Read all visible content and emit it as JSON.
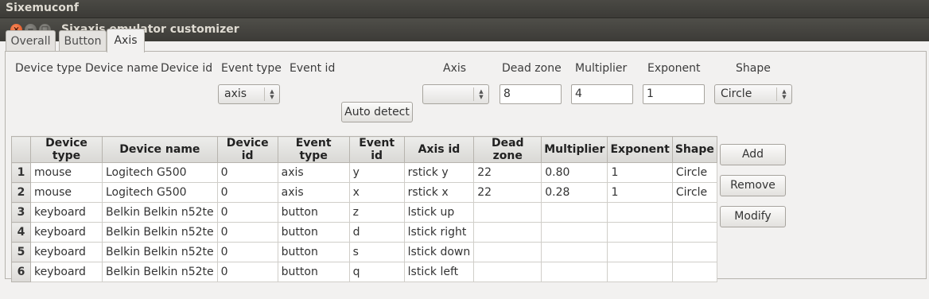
{
  "app": {
    "top_title": "Sixemuconf"
  },
  "window": {
    "title": "Sixaxis emulator customizer",
    "close_glyph": "×",
    "min_glyph": "−",
    "max_glyph": "□"
  },
  "tabs": [
    {
      "label": "Overall"
    },
    {
      "label": "Button"
    },
    {
      "label": "Axis",
      "active": true
    }
  ],
  "form": {
    "labels": {
      "device_type": "Device type",
      "device_name": "Device name",
      "device_id": "Device id",
      "event_type": "Event type",
      "event_id": "Event id",
      "axis": "Axis",
      "dead_zone": "Dead zone",
      "multiplier": "Multiplier",
      "exponent": "Exponent",
      "shape": "Shape"
    },
    "event_type_value": "axis",
    "auto_detect_label": "Auto detect",
    "axis_value": "",
    "dead_zone_value": "8",
    "multiplier_value": "4",
    "exponent_value": "1",
    "shape_value": "Circle"
  },
  "table": {
    "columns": [
      "Device type",
      "Device name",
      "Device id",
      "Event type",
      "Event id",
      "Axis id",
      "Dead zone",
      "Multiplier",
      "Exponent",
      "Shape"
    ],
    "rows": [
      {
        "num": "1",
        "cells": [
          "mouse",
          "Logitech G500",
          "0",
          "axis",
          "y",
          "rstick y",
          "22",
          "0.80",
          "1",
          "Circle"
        ]
      },
      {
        "num": "2",
        "cells": [
          "mouse",
          "Logitech G500",
          "0",
          "axis",
          "x",
          "rstick x",
          "22",
          "0.28",
          "1",
          "Circle"
        ]
      },
      {
        "num": "3",
        "cells": [
          "keyboard",
          "Belkin Belkin n52te",
          "0",
          "button",
          "z",
          "lstick up",
          "",
          "",
          "",
          ""
        ]
      },
      {
        "num": "4",
        "cells": [
          "keyboard",
          "Belkin Belkin n52te",
          "0",
          "button",
          "d",
          "lstick right",
          "",
          "",
          "",
          ""
        ]
      },
      {
        "num": "5",
        "cells": [
          "keyboard",
          "Belkin Belkin n52te",
          "0",
          "button",
          "s",
          "lstick down",
          "",
          "",
          "",
          ""
        ]
      },
      {
        "num": "6",
        "cells": [
          "keyboard",
          "Belkin Belkin n52te",
          "0",
          "button",
          "q",
          "lstick left",
          "",
          "",
          "",
          ""
        ]
      }
    ]
  },
  "actions": {
    "add_label": "Add",
    "remove_label": "Remove",
    "modify_label": "Modify"
  },
  "colors": {
    "titlebar": "#3c3b37",
    "window_bg": "#f2f1f0",
    "close_button": "#df4a16"
  }
}
